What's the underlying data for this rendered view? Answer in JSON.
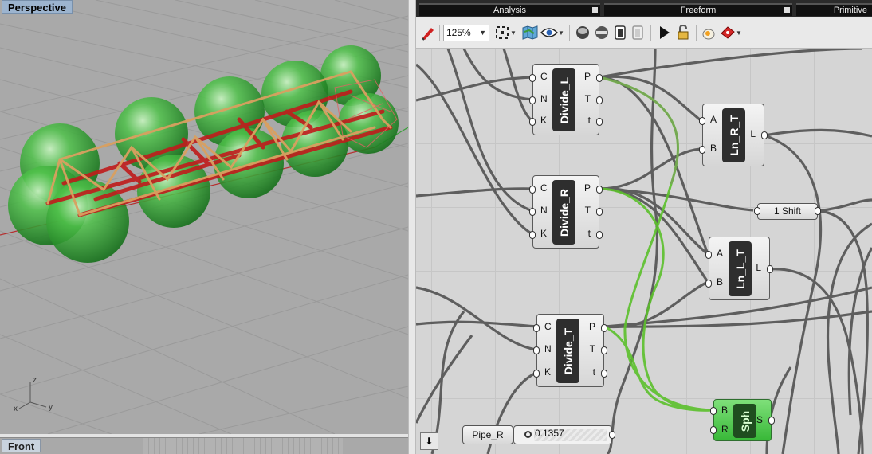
{
  "viewport": {
    "title": "Perspective",
    "bottom_tab": "Front",
    "axes": {
      "z": "z",
      "x": "x",
      "y": "y"
    }
  },
  "grasshopper": {
    "tabs": [
      {
        "label": "Analysis"
      },
      {
        "label": "Freeform"
      },
      {
        "label": "Primitive"
      }
    ],
    "toolbar": {
      "zoom": "125%",
      "icons": [
        "sketch-pen-icon",
        "zoom-extents-icon",
        "map-icon",
        "eye-icon",
        "preview-shaded-icon",
        "preview-wire-icon",
        "disable-icon",
        "disable-all-icon",
        "run-icon",
        "lock-icon",
        "bake-icon",
        "color-preset-icon"
      ]
    },
    "components": {
      "divide_l": {
        "nickname": "Divide_L",
        "inputs": [
          "C",
          "N",
          "K"
        ],
        "outputs": [
          "P",
          "T",
          "t"
        ]
      },
      "divide_r": {
        "nickname": "Divide_R",
        "inputs": [
          "C",
          "N",
          "K"
        ],
        "outputs": [
          "P",
          "T",
          "t"
        ]
      },
      "divide_t": {
        "nickname": "Divide_T",
        "inputs": [
          "C",
          "N",
          "K"
        ],
        "outputs": [
          "P",
          "T",
          "t"
        ]
      },
      "ln_r_t": {
        "nickname": "Ln_R_T",
        "inputs": [
          "A",
          "B"
        ],
        "outputs": [
          "L"
        ]
      },
      "ln_l_t": {
        "nickname": "Ln_L_T",
        "inputs": [
          "A",
          "B"
        ],
        "outputs": [
          "L"
        ]
      },
      "sph": {
        "nickname": "Sph",
        "inputs": [
          "B",
          "R"
        ],
        "outputs": [
          "S"
        ]
      },
      "shift": {
        "label": "1 Shift"
      },
      "pipe_r": {
        "label": "Pipe_R",
        "value": "0.1357"
      }
    },
    "corner_button": "⬇"
  }
}
